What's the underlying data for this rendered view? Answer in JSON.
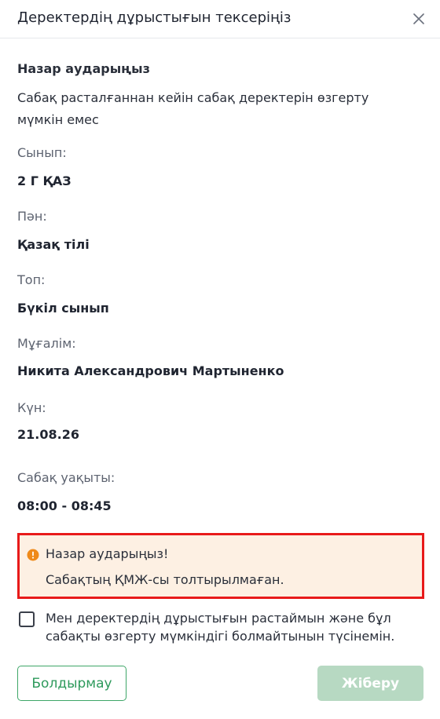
{
  "header": {
    "title": "Деректердің дұрыстығын тексеріңіз",
    "close_icon": "close-icon"
  },
  "notice": {
    "title": "Назар аударыңыз",
    "text": "Сабақ расталғаннан кейін сабақ деректерін өзгерту мүмкін емес"
  },
  "fields": {
    "class_label": "Сынып:",
    "class_value": "2 Г ҚАЗ",
    "subject_label": "Пән:",
    "subject_value": "Қазақ тілі",
    "group_label": "Топ:",
    "group_value": "Бүкіл сынып",
    "teacher_label": "Мұғалім:",
    "teacher_value": "Никита Александрович Мартыненко",
    "date_label": "Күн:",
    "date_value": "21.08.26",
    "time_label": "Сабақ уақыты:",
    "time_value": "08:00 - 08:45"
  },
  "alert": {
    "icon": "warning-icon",
    "title": "Назар аударыңыз!",
    "text": "Сабақтың ҚМЖ-сы толтырылмаған.",
    "border_color": "#e81a1a",
    "background": "#fdf0e3"
  },
  "confirm": {
    "checked": false,
    "text": "Мен деректердің дұрыстығын растаймын және бұл сабақты өзгерту мүмкіндігі болмайтынын түсінемін."
  },
  "buttons": {
    "cancel_label": "Болдырмау",
    "submit_label": "Жіберу",
    "submit_enabled": false
  },
  "colors": {
    "accent": "#3ea668",
    "submit_disabled": "#b7d9c2",
    "warning": "#ef8a1a"
  }
}
